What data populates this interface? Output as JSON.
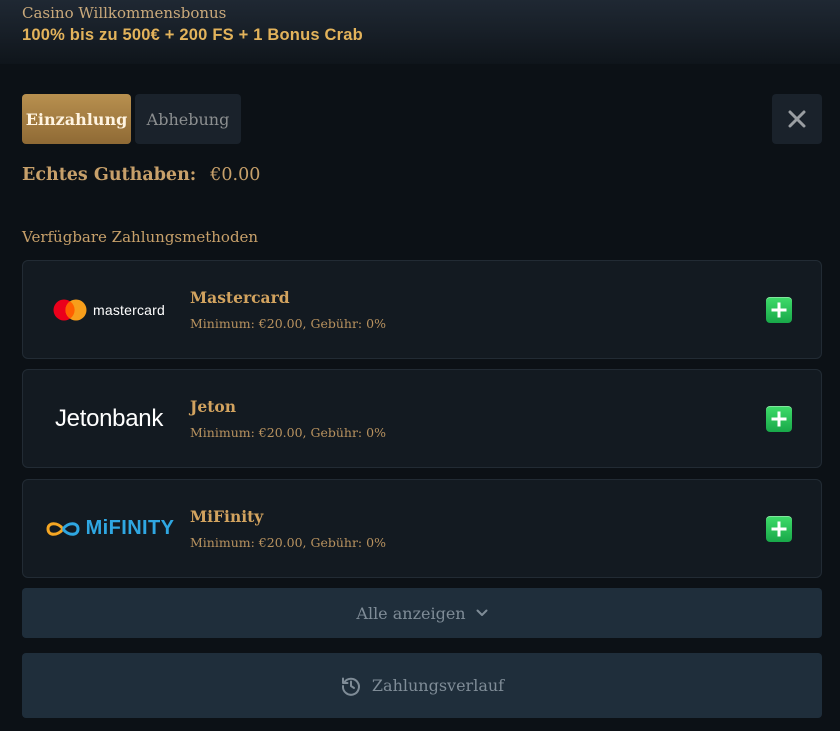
{
  "banner": {
    "label": "Casino Willkommensbonus",
    "title": "100% bis zu 500€ + 200 FS + 1 Bonus Crab"
  },
  "tabs": [
    {
      "label": "Einzahlung",
      "active": true
    },
    {
      "label": "Abhebung",
      "active": false
    }
  ],
  "close": {
    "icon": "close-icon"
  },
  "balance": {
    "label": "Echtes Guthaben:",
    "value": "€0.00"
  },
  "methods_title": "Verfügbare Zahlungsmethoden",
  "methods": [
    {
      "logo_text": "mastercard",
      "name": "Mastercard",
      "info": "Minimum: €20.00, Gebühr: 0%"
    },
    {
      "logo_text": "Jetonbank",
      "name": "Jeton",
      "info": "Minimum: €20.00, Gebühr: 0%"
    },
    {
      "logo_text": "MiFINITY",
      "name": "MiFinity",
      "info": "Minimum: €20.00, Gebühr: 0%"
    }
  ],
  "show_all": {
    "label": "Alle anzeigen",
    "icon": "chevron-down-icon"
  },
  "history": {
    "label": "Zahlungsverlauf",
    "icon": "history-icon"
  },
  "colors": {
    "background": "#0c1116",
    "accent_gold": "#c7a06a",
    "title_gold": "#e3b35b",
    "card": "#131a21",
    "button": "#1f2e3b",
    "add_green": "#27c45a"
  }
}
